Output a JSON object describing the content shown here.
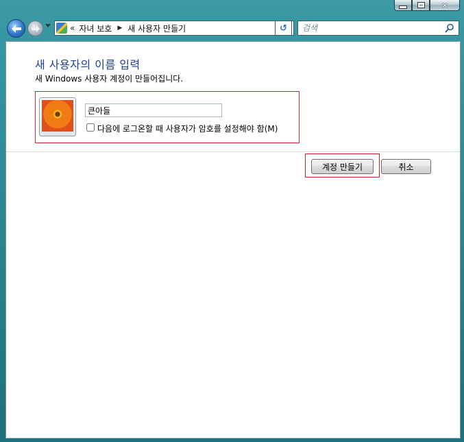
{
  "window": {
    "controls": {
      "minimize_icon": "minimize-icon",
      "maximize_icon": "maximize-icon",
      "close_icon": "close-icon"
    }
  },
  "nav": {
    "back_icon": "back-arrow-icon",
    "forward_icon": "forward-arrow-icon",
    "breadcrumb_prefix": "«",
    "breadcrumbs": [
      "자녀 보호",
      "새 사용자 만들기"
    ],
    "search": {
      "placeholder": "검색"
    }
  },
  "page": {
    "title": "새 사용자의 이름 입력",
    "subtitle": "새 Windows 사용자 계정이 만들어집니다.",
    "username_value": "큰아들",
    "require_password_label": "다음에 로그온할 때 사용자가 암호를 설정해야 함(M)",
    "require_password_checked": false
  },
  "buttons": {
    "create_label": "계정 만들기",
    "cancel_label": "취소"
  },
  "colors": {
    "highlight_outline": "#c8232c",
    "title_color": "#1e3f8f"
  }
}
